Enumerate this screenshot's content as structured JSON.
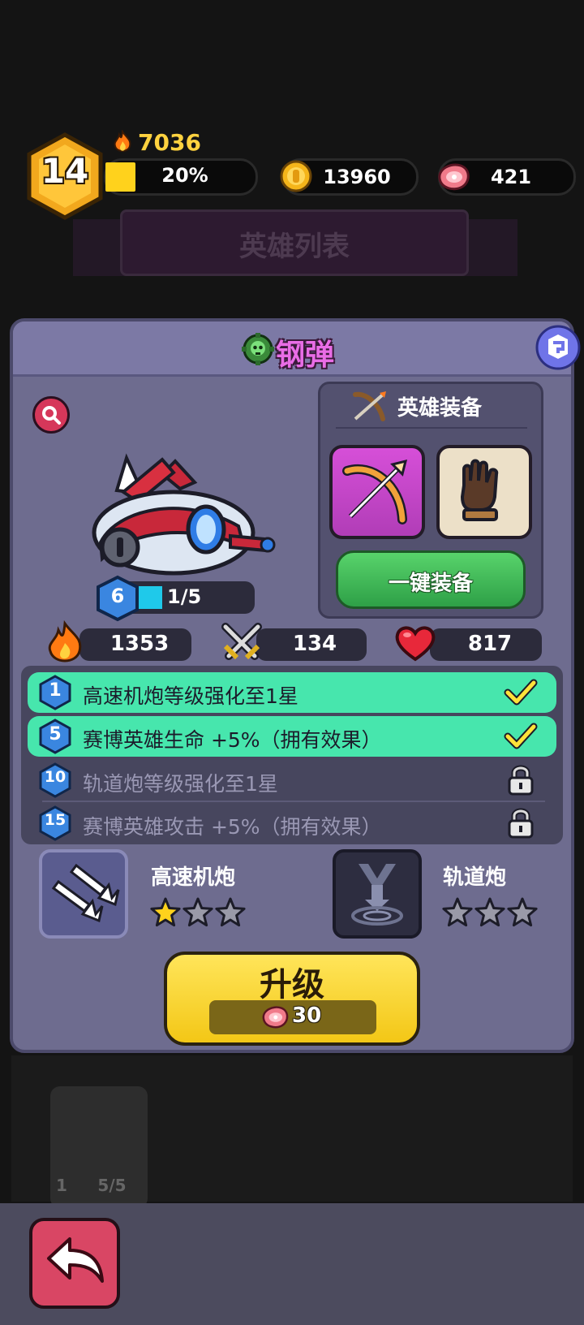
{
  "player": {
    "level": "14",
    "power": "7036",
    "xp_percent": "20%",
    "xp_fraction": 0.2,
    "coins": "13960",
    "meat": "421"
  },
  "background": {
    "list_title": "英雄列表",
    "card_level": "1",
    "card_shards": "5/5"
  },
  "hero": {
    "name": "钢弹",
    "name_color": "#e96de6",
    "star_level": "6",
    "shards": "1/5",
    "stats": {
      "power": "1353",
      "attack": "134",
      "health": "817"
    }
  },
  "equipment": {
    "title": "英雄装备",
    "slots": [
      "bow-icon",
      "glove-icon"
    ],
    "equip_all_label": "一键装备"
  },
  "perks": [
    {
      "level": "1",
      "text": "高速机炮等级强化至1星",
      "unlocked": true
    },
    {
      "level": "5",
      "text": "赛博英雄生命  +5%（拥有效果）",
      "unlocked": true
    },
    {
      "level": "10",
      "text": "轨道炮等级强化至1星",
      "unlocked": false
    },
    {
      "level": "15",
      "text": "赛博英雄攻击  +5%（拥有效果）",
      "unlocked": false
    }
  ],
  "skills": [
    {
      "name": "高速机炮",
      "stars": 1,
      "max_stars": 3
    },
    {
      "name": "轨道炮",
      "stars": 0,
      "max_stars": 3
    }
  ],
  "upgrade": {
    "label": "升级",
    "cost": "30"
  },
  "colors": {
    "accent_green": "#47e6ad",
    "upgrade_yellow": "#f3c716",
    "back_red": "#d94664"
  }
}
